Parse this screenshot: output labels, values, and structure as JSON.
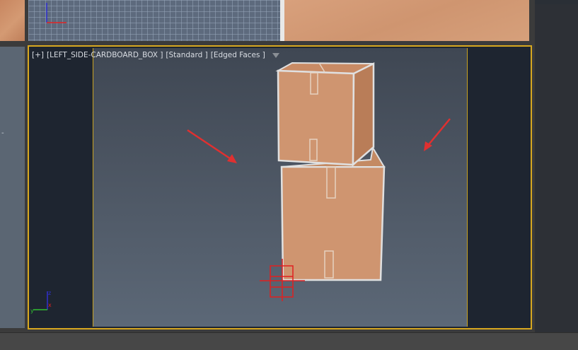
{
  "viewport": {
    "label_parts": [
      "[+]",
      "[LEFT_SIDE-CARDBOARD_BOX ]",
      "[Standard ]",
      "[Edged Faces ]"
    ],
    "filter_icon": "funnel-icon"
  },
  "colors": {
    "active_border": "#d8a820",
    "cardboard": "#cf9570",
    "arrow": "#e03030",
    "gizmo": "#e02020"
  },
  "annotation_arrows": 2
}
